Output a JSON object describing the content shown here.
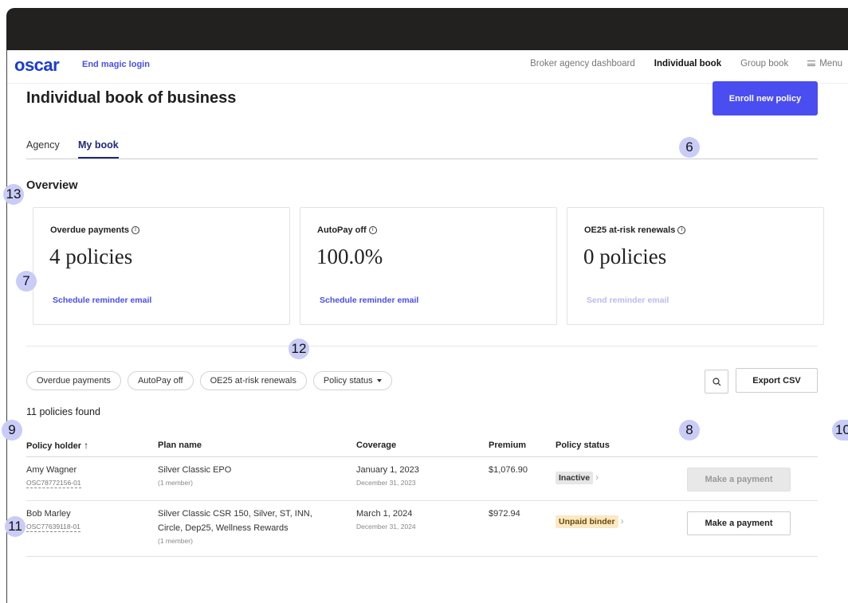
{
  "nav": {
    "logo": "oscar",
    "end_magic_login": "End magic login",
    "links": [
      "Broker agency dashboard",
      "Individual book",
      "Group book",
      "Menu"
    ]
  },
  "badges": {
    "b6": "6",
    "b7": "7",
    "b8": "8",
    "b9": "9",
    "b10": "10",
    "b11": "11",
    "b12": "12",
    "b13": "13"
  },
  "page": {
    "title": "Individual book of business",
    "enroll_label": "Enroll new policy",
    "tabs": [
      "Agency",
      "My book"
    ],
    "overview_title": "Overview"
  },
  "cards": [
    {
      "label": "Overdue payments",
      "value": "4 policies",
      "action": "Schedule reminder email"
    },
    {
      "label": "AutoPay off",
      "value": "100.0%",
      "action": "Schedule reminder email"
    },
    {
      "label": "OE25 at-risk renewals",
      "value": "0 policies",
      "action": "Send reminder email"
    }
  ],
  "filters": {
    "chips": [
      "Overdue payments",
      "AutoPay off",
      "OE25 at-risk renewals",
      "Policy status"
    ],
    "export_label": "Export CSV"
  },
  "results": {
    "found_text": "11 policies found"
  },
  "table": {
    "headers": [
      "Policy holder",
      "Plan name",
      "Coverage",
      "Premium",
      "Policy status"
    ],
    "rows": [
      {
        "name": "Amy Wagner",
        "id": "OSC78772156-01",
        "plan": "Silver Classic EPO",
        "members": "(1 member)",
        "coverage_start": "January 1, 2023",
        "coverage_end": "December 31, 2023",
        "premium": "$1,076.90",
        "status": "Inactive",
        "action": "Make a payment"
      },
      {
        "name": "Bob Marley",
        "id": "OSC77639118-01",
        "plan_line1": "Silver Classic CSR 150, Silver, ST, INN,",
        "plan_line2": "Circle, Dep25, Wellness Rewards",
        "members": "(1 member)",
        "coverage_start": "March 1, 2024",
        "coverage_end": "December 31, 2024",
        "premium": "$972.94",
        "status": "Unpaid binder",
        "action": "Make a payment"
      }
    ]
  },
  "colors": {
    "accent": "#4a4df0",
    "badge": "#c9ccf6",
    "topbar": "#232020"
  }
}
